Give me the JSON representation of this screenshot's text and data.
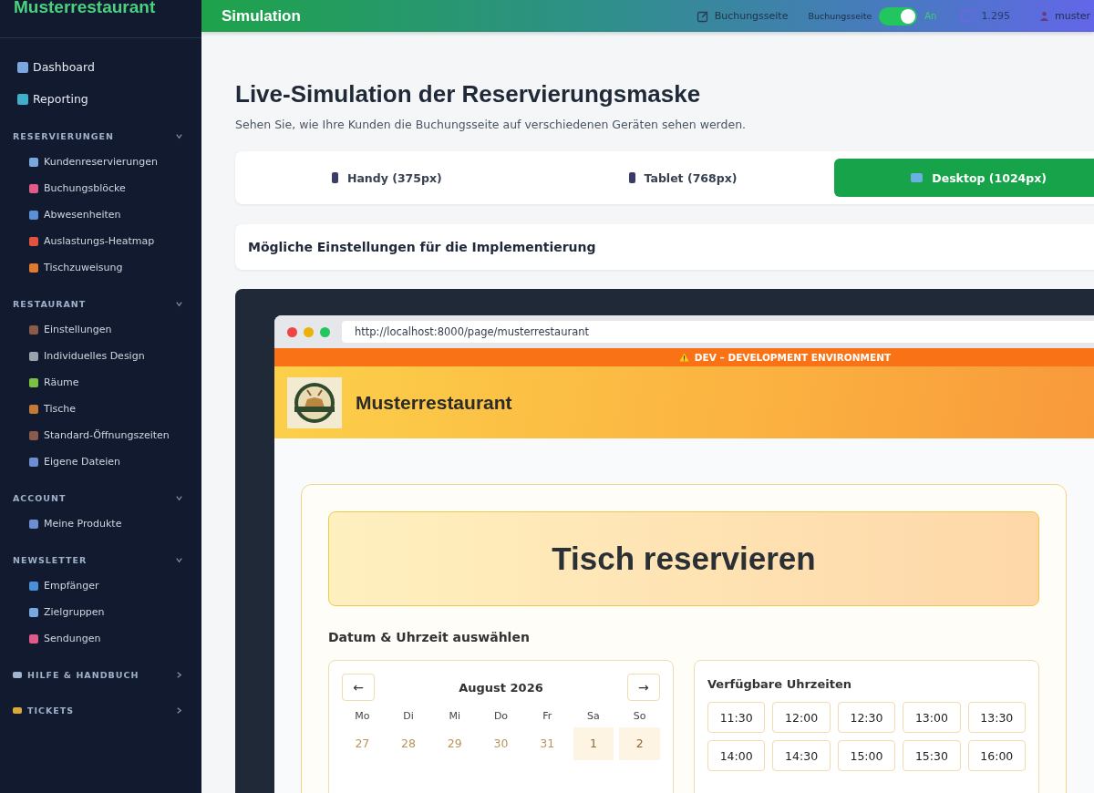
{
  "sidebar": {
    "brand": "Musterrestaurant",
    "top_items": [
      {
        "label": "Dashboard",
        "selected": false
      },
      {
        "label": "Reporting",
        "selected": false
      }
    ],
    "sections": [
      {
        "title": "RESERVIERUNGEN",
        "expanded": true,
        "items": [
          {
            "label": "Kundenreservierungen"
          },
          {
            "label": "Buchungsblöcke"
          },
          {
            "label": "Abwesenheiten"
          },
          {
            "label": "Auslastungs-Heatmap"
          },
          {
            "label": "Tischzuweisung"
          }
        ]
      },
      {
        "title": "RESTAURANT",
        "expanded": true,
        "items": [
          {
            "label": "Einstellungen"
          },
          {
            "label": "Individuelles Design"
          },
          {
            "label": "Räume"
          },
          {
            "label": "Tische"
          },
          {
            "label": "Standard-Öffnungszeiten"
          },
          {
            "label": "Eigene Dateien"
          }
        ]
      },
      {
        "title": "ACCOUNT",
        "expanded": true,
        "items": [
          {
            "label": "Meine Produkte"
          }
        ]
      },
      {
        "title": "NEWSLETTER",
        "expanded": true,
        "items": [
          {
            "label": "Empfänger"
          },
          {
            "label": "Zielgruppen"
          },
          {
            "label": "Sendungen"
          }
        ]
      },
      {
        "title": "HILFE & HANDBUCH",
        "expanded": false
      },
      {
        "title": "TICKETS",
        "expanded": false
      }
    ]
  },
  "topbar": {
    "title": "Simulation",
    "booking_link": "Buchungsseite",
    "toggle_label": "Buchungsseite",
    "toggle": {
      "on": true,
      "state_text": "An"
    },
    "credits": "1.295",
    "user": "muster"
  },
  "page": {
    "title": "Live-Simulation der Reservierungsmaske",
    "subtitle": "Sehen Sie, wie Ihre Kunden die Buchungsseite auf verschiedenen Geräten sehen werden.",
    "device_tabs": [
      {
        "label": "Handy (375px)",
        "selected": false
      },
      {
        "label": "Tablet (768px)",
        "selected": false
      },
      {
        "label": "Desktop (1024px)",
        "selected": true
      }
    ],
    "settings_panel": {
      "title": "Mögliche Einstellungen für die Implementierung",
      "expanded": false
    }
  },
  "preview": {
    "url": "http://localhost:8000/page/musterrestaurant",
    "dev_banner": "DEV – DEVELOPMENT ENVIRONMENT",
    "restaurant_name": "Musterrestaurant",
    "heading": "Tisch reservieren",
    "section_title": "Datum & Uhrzeit auswählen",
    "calendar": {
      "prev": "←",
      "month": "August 2026",
      "next": "→",
      "weekdays": [
        "Mo",
        "Di",
        "Mi",
        "Do",
        "Fr",
        "Sa",
        "So"
      ],
      "days": [
        {
          "label": "27",
          "kind": "other"
        },
        {
          "label": "28",
          "kind": "other"
        },
        {
          "label": "29",
          "kind": "other"
        },
        {
          "label": "30",
          "kind": "other"
        },
        {
          "label": "31",
          "kind": "other"
        },
        {
          "label": "1",
          "kind": "weekend"
        },
        {
          "label": "2",
          "kind": "weekend"
        }
      ]
    },
    "times_title": "Verfügbare Uhrzeiten",
    "times": [
      "11:30",
      "12:00",
      "12:30",
      "13:00",
      "13:30",
      "14:00",
      "14:30",
      "15:00",
      "15:30",
      "16:00"
    ]
  }
}
